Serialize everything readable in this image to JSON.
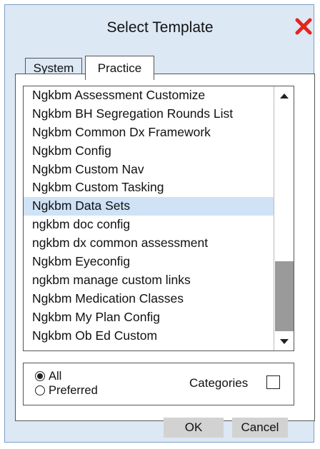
{
  "dialog": {
    "title": "Select Template",
    "tabs": [
      {
        "label": "System",
        "active": false
      },
      {
        "label": "Practice",
        "active": true
      }
    ],
    "list": {
      "items": [
        "Ngkbm Assessment Customize",
        "Ngkbm BH Segregation Rounds List",
        "Ngkbm Common Dx Framework",
        "Ngkbm Config",
        "Ngkbm Custom Nav",
        "Ngkbm Custom Tasking",
        "Ngkbm Data Sets",
        "ngkbm doc config",
        "ngkbm dx common assessment",
        "Ngkbm Eyeconfig",
        "ngkbm manage custom links",
        "Ngkbm Medication Classes",
        "Ngkbm My Plan Config",
        "Ngkbm Ob Ed Custom"
      ],
      "selected_index": 6
    },
    "filter": {
      "all_label": "All",
      "preferred_label": "Preferred",
      "selected": "All",
      "categories_label": "Categories",
      "categories_checked": false
    },
    "buttons": {
      "ok": "OK",
      "cancel": "Cancel"
    }
  },
  "colors": {
    "dialog_bg": "#dde8f5",
    "selected_row": "#cfe2f6",
    "close_icon": "#e8231a",
    "button_bg": "#d2d2d2"
  },
  "icons": {
    "close": "close-x-icon"
  }
}
